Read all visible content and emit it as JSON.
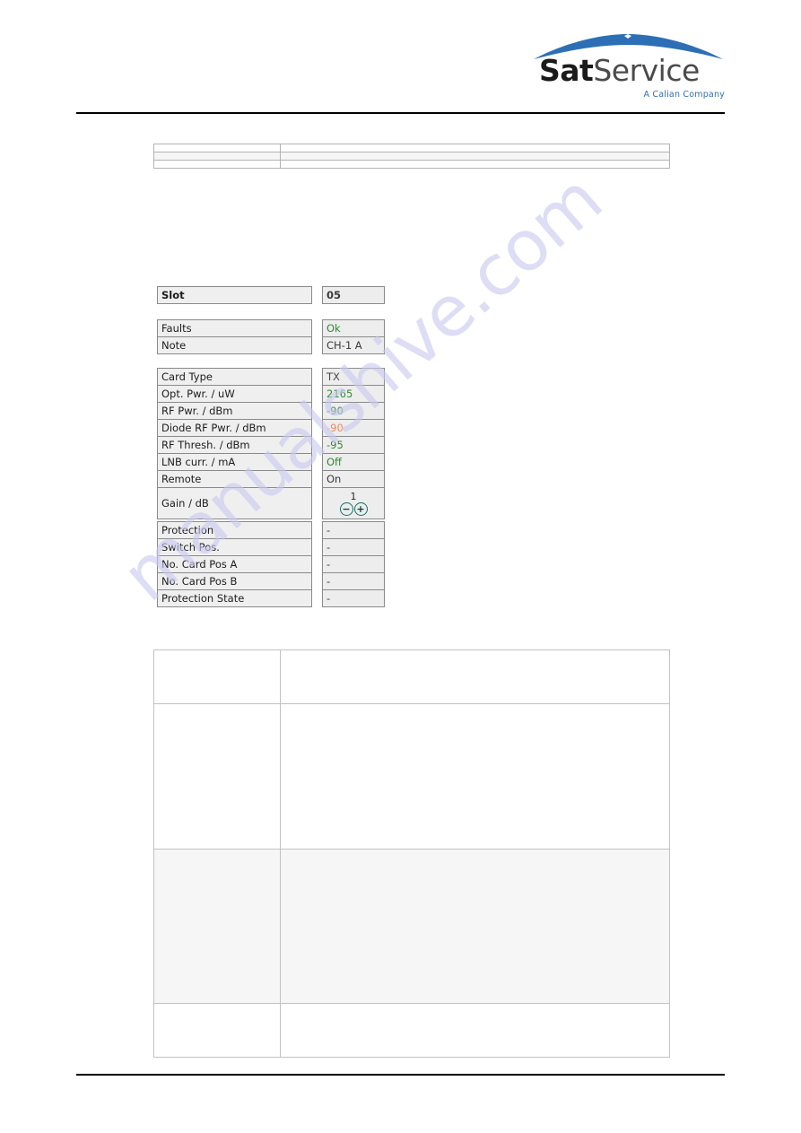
{
  "brand": {
    "wordmark_bold": "Sat",
    "wordmark_light": "Service",
    "tagline": "A Calian Company",
    "swoosh_color": "#2d6fb5",
    "tagline_color": "#2f6fb0"
  },
  "watermark": {
    "text": "manualshive.com",
    "color": "#c9c9ef"
  },
  "top_doc_table": {
    "rows": [
      {
        "shaded": false,
        "col1": "",
        "col2": ""
      },
      {
        "shaded": true,
        "col1": "",
        "col2": ""
      },
      {
        "shaded": false,
        "col1": "",
        "col2": ""
      }
    ]
  },
  "bottom_doc_table": {
    "rows": [
      {
        "shaded": false,
        "col1": "",
        "col2": ""
      },
      {
        "shaded": false,
        "col1": "",
        "col2": ""
      },
      {
        "shaded": false,
        "col1": "",
        "col2": ""
      },
      {
        "shaded": false,
        "col1": "",
        "col2": ""
      }
    ]
  },
  "device_ui": {
    "slot_panel": {
      "label": "Slot",
      "value": "05"
    },
    "status_panel": {
      "rows": [
        {
          "label": "Faults",
          "value": "Ok",
          "value_color": "green"
        },
        {
          "label": "Note",
          "value": "CH-1 A",
          "value_color": "dark"
        }
      ]
    },
    "card_panel": {
      "rows": [
        {
          "label": "Card Type",
          "value": "TX",
          "value_color": "muted"
        },
        {
          "label": "Opt. Pwr. / uW",
          "value": "2165",
          "value_color": "green"
        },
        {
          "label": "RF Pwr. / dBm",
          "value": "-90",
          "value_color": "green"
        },
        {
          "label": "Diode RF Pwr. / dBm",
          "value": "-90",
          "value_color": "orange"
        },
        {
          "label": "RF Thresh. / dBm",
          "value": "-95",
          "value_color": "green"
        },
        {
          "label": "LNB curr. / mA",
          "value": "Off",
          "value_color": "green"
        },
        {
          "label": "Remote",
          "value": "On",
          "value_color": "dark"
        }
      ],
      "gain_row": {
        "label": "Gain / dB",
        "value": "1",
        "decrement_label": "−",
        "increment_label": "+"
      }
    },
    "protection_panel": {
      "rows": [
        {
          "label": "Protection",
          "value": "-"
        },
        {
          "label": "Switch Pos.",
          "value": "-"
        },
        {
          "label": "No. Card Pos A",
          "value": "-"
        },
        {
          "label": "No. Card Pos B",
          "value": "-"
        },
        {
          "label": "Protection State",
          "value": "-"
        }
      ]
    }
  }
}
